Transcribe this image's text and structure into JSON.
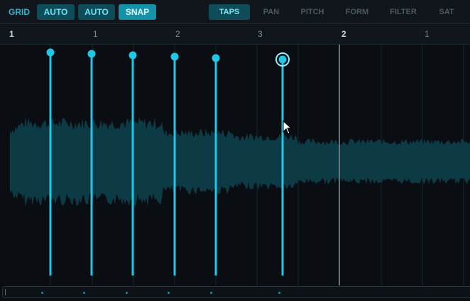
{
  "toolbar": {
    "grid_label": "GRID",
    "buttons": [
      {
        "label": "AUTO",
        "state": "on"
      },
      {
        "label": "AUTO",
        "state": "on"
      },
      {
        "label": "SNAP",
        "state": "active"
      }
    ],
    "tabs": [
      {
        "label": "TAPS",
        "active": true
      },
      {
        "label": "PAN",
        "active": false
      },
      {
        "label": "PITCH",
        "active": false
      },
      {
        "label": "FORM",
        "active": false
      },
      {
        "label": "FILTER",
        "active": false
      },
      {
        "label": "SAT",
        "active": false
      }
    ]
  },
  "ruler": {
    "labels": [
      "1",
      "1",
      "2",
      "3",
      "2",
      "1"
    ]
  },
  "taps": {
    "count": 6,
    "selected_index": 5
  },
  "colors": {
    "accent": "#1ec8e6",
    "waveform": "#0c3a45",
    "background": "#0a0d12",
    "playhead": "#6a737c"
  }
}
